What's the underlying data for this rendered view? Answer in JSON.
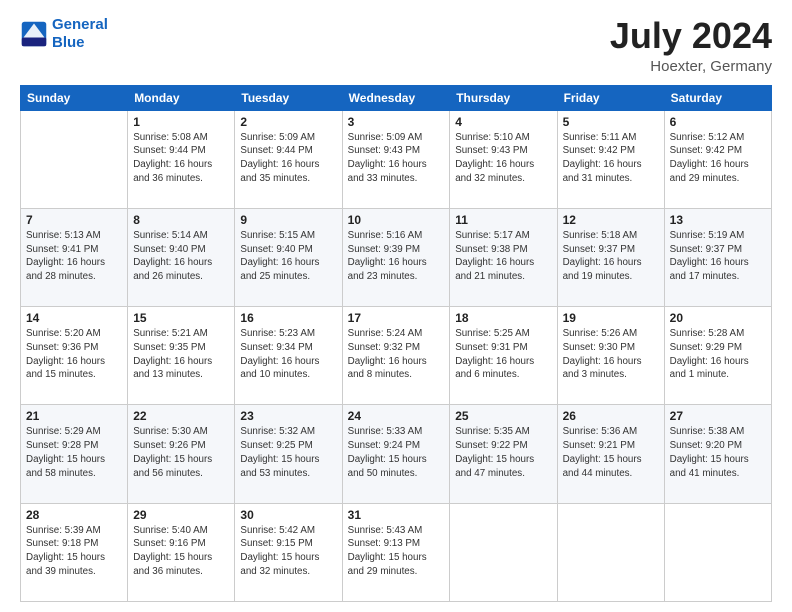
{
  "logo": {
    "line1": "General",
    "line2": "Blue"
  },
  "title": "July 2024",
  "subtitle": "Hoexter, Germany",
  "weekdays": [
    "Sunday",
    "Monday",
    "Tuesday",
    "Wednesday",
    "Thursday",
    "Friday",
    "Saturday"
  ],
  "weeks": [
    [
      {
        "day": "",
        "info": ""
      },
      {
        "day": "1",
        "info": "Sunrise: 5:08 AM\nSunset: 9:44 PM\nDaylight: 16 hours\nand 36 minutes."
      },
      {
        "day": "2",
        "info": "Sunrise: 5:09 AM\nSunset: 9:44 PM\nDaylight: 16 hours\nand 35 minutes."
      },
      {
        "day": "3",
        "info": "Sunrise: 5:09 AM\nSunset: 9:43 PM\nDaylight: 16 hours\nand 33 minutes."
      },
      {
        "day": "4",
        "info": "Sunrise: 5:10 AM\nSunset: 9:43 PM\nDaylight: 16 hours\nand 32 minutes."
      },
      {
        "day": "5",
        "info": "Sunrise: 5:11 AM\nSunset: 9:42 PM\nDaylight: 16 hours\nand 31 minutes."
      },
      {
        "day": "6",
        "info": "Sunrise: 5:12 AM\nSunset: 9:42 PM\nDaylight: 16 hours\nand 29 minutes."
      }
    ],
    [
      {
        "day": "7",
        "info": "Sunrise: 5:13 AM\nSunset: 9:41 PM\nDaylight: 16 hours\nand 28 minutes."
      },
      {
        "day": "8",
        "info": "Sunrise: 5:14 AM\nSunset: 9:40 PM\nDaylight: 16 hours\nand 26 minutes."
      },
      {
        "day": "9",
        "info": "Sunrise: 5:15 AM\nSunset: 9:40 PM\nDaylight: 16 hours\nand 25 minutes."
      },
      {
        "day": "10",
        "info": "Sunrise: 5:16 AM\nSunset: 9:39 PM\nDaylight: 16 hours\nand 23 minutes."
      },
      {
        "day": "11",
        "info": "Sunrise: 5:17 AM\nSunset: 9:38 PM\nDaylight: 16 hours\nand 21 minutes."
      },
      {
        "day": "12",
        "info": "Sunrise: 5:18 AM\nSunset: 9:37 PM\nDaylight: 16 hours\nand 19 minutes."
      },
      {
        "day": "13",
        "info": "Sunrise: 5:19 AM\nSunset: 9:37 PM\nDaylight: 16 hours\nand 17 minutes."
      }
    ],
    [
      {
        "day": "14",
        "info": "Sunrise: 5:20 AM\nSunset: 9:36 PM\nDaylight: 16 hours\nand 15 minutes."
      },
      {
        "day": "15",
        "info": "Sunrise: 5:21 AM\nSunset: 9:35 PM\nDaylight: 16 hours\nand 13 minutes."
      },
      {
        "day": "16",
        "info": "Sunrise: 5:23 AM\nSunset: 9:34 PM\nDaylight: 16 hours\nand 10 minutes."
      },
      {
        "day": "17",
        "info": "Sunrise: 5:24 AM\nSunset: 9:32 PM\nDaylight: 16 hours\nand 8 minutes."
      },
      {
        "day": "18",
        "info": "Sunrise: 5:25 AM\nSunset: 9:31 PM\nDaylight: 16 hours\nand 6 minutes."
      },
      {
        "day": "19",
        "info": "Sunrise: 5:26 AM\nSunset: 9:30 PM\nDaylight: 16 hours\nand 3 minutes."
      },
      {
        "day": "20",
        "info": "Sunrise: 5:28 AM\nSunset: 9:29 PM\nDaylight: 16 hours\nand 1 minute."
      }
    ],
    [
      {
        "day": "21",
        "info": "Sunrise: 5:29 AM\nSunset: 9:28 PM\nDaylight: 15 hours\nand 58 minutes."
      },
      {
        "day": "22",
        "info": "Sunrise: 5:30 AM\nSunset: 9:26 PM\nDaylight: 15 hours\nand 56 minutes."
      },
      {
        "day": "23",
        "info": "Sunrise: 5:32 AM\nSunset: 9:25 PM\nDaylight: 15 hours\nand 53 minutes."
      },
      {
        "day": "24",
        "info": "Sunrise: 5:33 AM\nSunset: 9:24 PM\nDaylight: 15 hours\nand 50 minutes."
      },
      {
        "day": "25",
        "info": "Sunrise: 5:35 AM\nSunset: 9:22 PM\nDaylight: 15 hours\nand 47 minutes."
      },
      {
        "day": "26",
        "info": "Sunrise: 5:36 AM\nSunset: 9:21 PM\nDaylight: 15 hours\nand 44 minutes."
      },
      {
        "day": "27",
        "info": "Sunrise: 5:38 AM\nSunset: 9:20 PM\nDaylight: 15 hours\nand 41 minutes."
      }
    ],
    [
      {
        "day": "28",
        "info": "Sunrise: 5:39 AM\nSunset: 9:18 PM\nDaylight: 15 hours\nand 39 minutes."
      },
      {
        "day": "29",
        "info": "Sunrise: 5:40 AM\nSunset: 9:16 PM\nDaylight: 15 hours\nand 36 minutes."
      },
      {
        "day": "30",
        "info": "Sunrise: 5:42 AM\nSunset: 9:15 PM\nDaylight: 15 hours\nand 32 minutes."
      },
      {
        "day": "31",
        "info": "Sunrise: 5:43 AM\nSunset: 9:13 PM\nDaylight: 15 hours\nand 29 minutes."
      },
      {
        "day": "",
        "info": ""
      },
      {
        "day": "",
        "info": ""
      },
      {
        "day": "",
        "info": ""
      }
    ]
  ]
}
